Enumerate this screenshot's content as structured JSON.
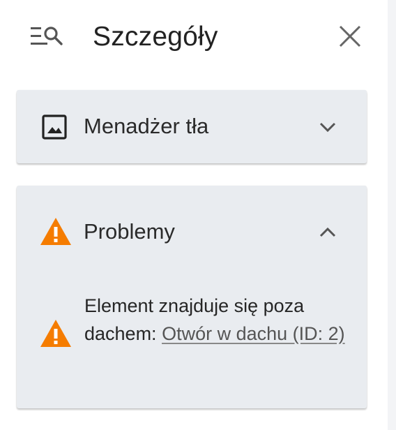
{
  "header": {
    "title": "Szczegóły",
    "icon": "details-search-icon",
    "close_icon": "close-icon"
  },
  "sections": {
    "background_manager": {
      "label": "Menadżer tła",
      "icon": "image-icon",
      "expanded": false
    },
    "problems": {
      "label": "Problemy",
      "icon": "warning-icon",
      "expanded": true,
      "items": [
        {
          "icon": "warning-icon",
          "text": "Element znajduje się poza dachem: ",
          "link_text": "Otwór w dachu (ID: 2)"
        }
      ]
    }
  },
  "colors": {
    "card_background": "#e9ecf0",
    "warning": "#f57c00",
    "text": "#2b2b2b"
  }
}
